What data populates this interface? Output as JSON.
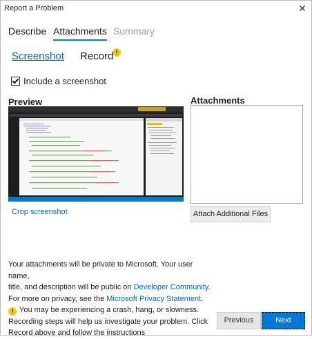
{
  "window": {
    "title": "Report a Problem",
    "close_glyph": "✕"
  },
  "tabs": [
    {
      "label": "Describe",
      "state": "inactive"
    },
    {
      "label": "Attachments",
      "state": "active"
    },
    {
      "label": "Summary",
      "state": "disabled"
    }
  ],
  "subtabs": {
    "screenshot": "Screenshot",
    "record": "Record",
    "record_badge_icon": "warning-icon",
    "warn_glyph": "!"
  },
  "screenshot": {
    "include_label": "Include a screenshot",
    "include_checked": true,
    "preview_label": "Preview",
    "crop_label": "Crop screenshot"
  },
  "attachments": {
    "label": "Attachments",
    "attach_button": "Attach Additional Files"
  },
  "info": {
    "line1": "Your attachments will be private to Microsoft. Your user name,",
    "line2_pre": "title, and description will be public on ",
    "line2_link": "Developer Community",
    "line2_post": ".",
    "line3_pre": "For more on privacy, see the ",
    "line3_link": "Microsoft Privacy Statement",
    "line3_post": ".",
    "line4": "You may be experiencing a crash, hang, or slowness.",
    "line5": "Recording steps will help us investigate your problem. Click",
    "line6": "Record above and follow the instructions"
  },
  "buttons": {
    "previous": "Previous",
    "next": "Next"
  },
  "colors": {
    "accent": "#0078d7",
    "link": "#0066cc",
    "warning": "#f2c811",
    "disabled": "#9b9b9b"
  }
}
